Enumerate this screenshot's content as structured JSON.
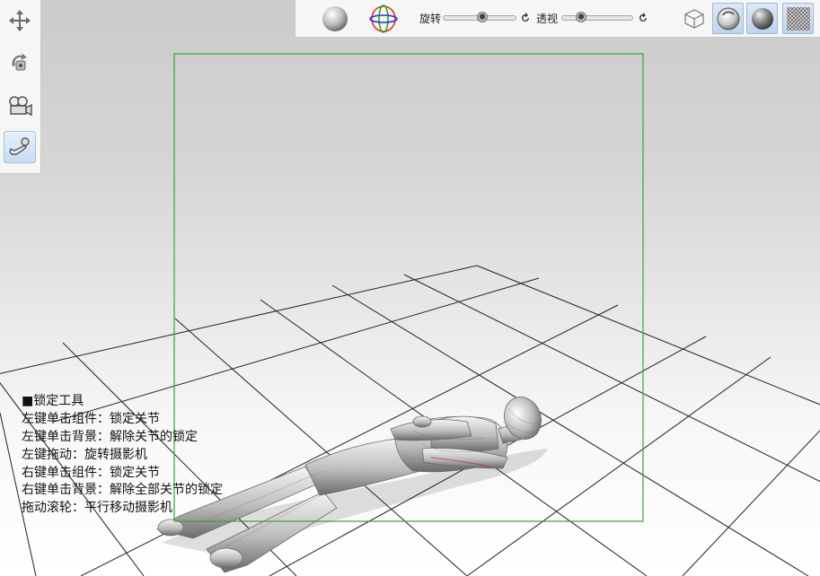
{
  "left_toolbar": {
    "items": [
      {
        "icon": "move-arrows-icon",
        "active": false
      },
      {
        "icon": "pose-rotate-icon",
        "active": false
      },
      {
        "icon": "camera-icon",
        "active": false
      },
      {
        "icon": "joint-lock-icon",
        "active": true
      }
    ]
  },
  "top_toolbar": {
    "rotate_label": "旋转",
    "rotate_value": 0.55,
    "perspective_label": "透视",
    "perspective_value": 0.22,
    "icons": [
      "shading-sphere-icon",
      "gizmo-axes-icon",
      "reset-rotate-icon",
      "reset-perspective-icon",
      "wireframe-cube-icon",
      "lighting-sphere-icon",
      "shaded-sphere-icon",
      "background-pattern-icon"
    ]
  },
  "colors": {
    "accent": "#bfd4ee",
    "frame": "#2faa2f"
  },
  "hint": {
    "title": "■锁定工具",
    "lines": [
      "左键单击组件：锁定关节",
      "左键单击背景：解除关节的锁定",
      "左键拖动：旋转摄影机",
      "右键单击组件：锁定关节",
      "右键单击背景：解除全部关节的锁定",
      "拖动滚轮：平行移动摄影机"
    ]
  }
}
